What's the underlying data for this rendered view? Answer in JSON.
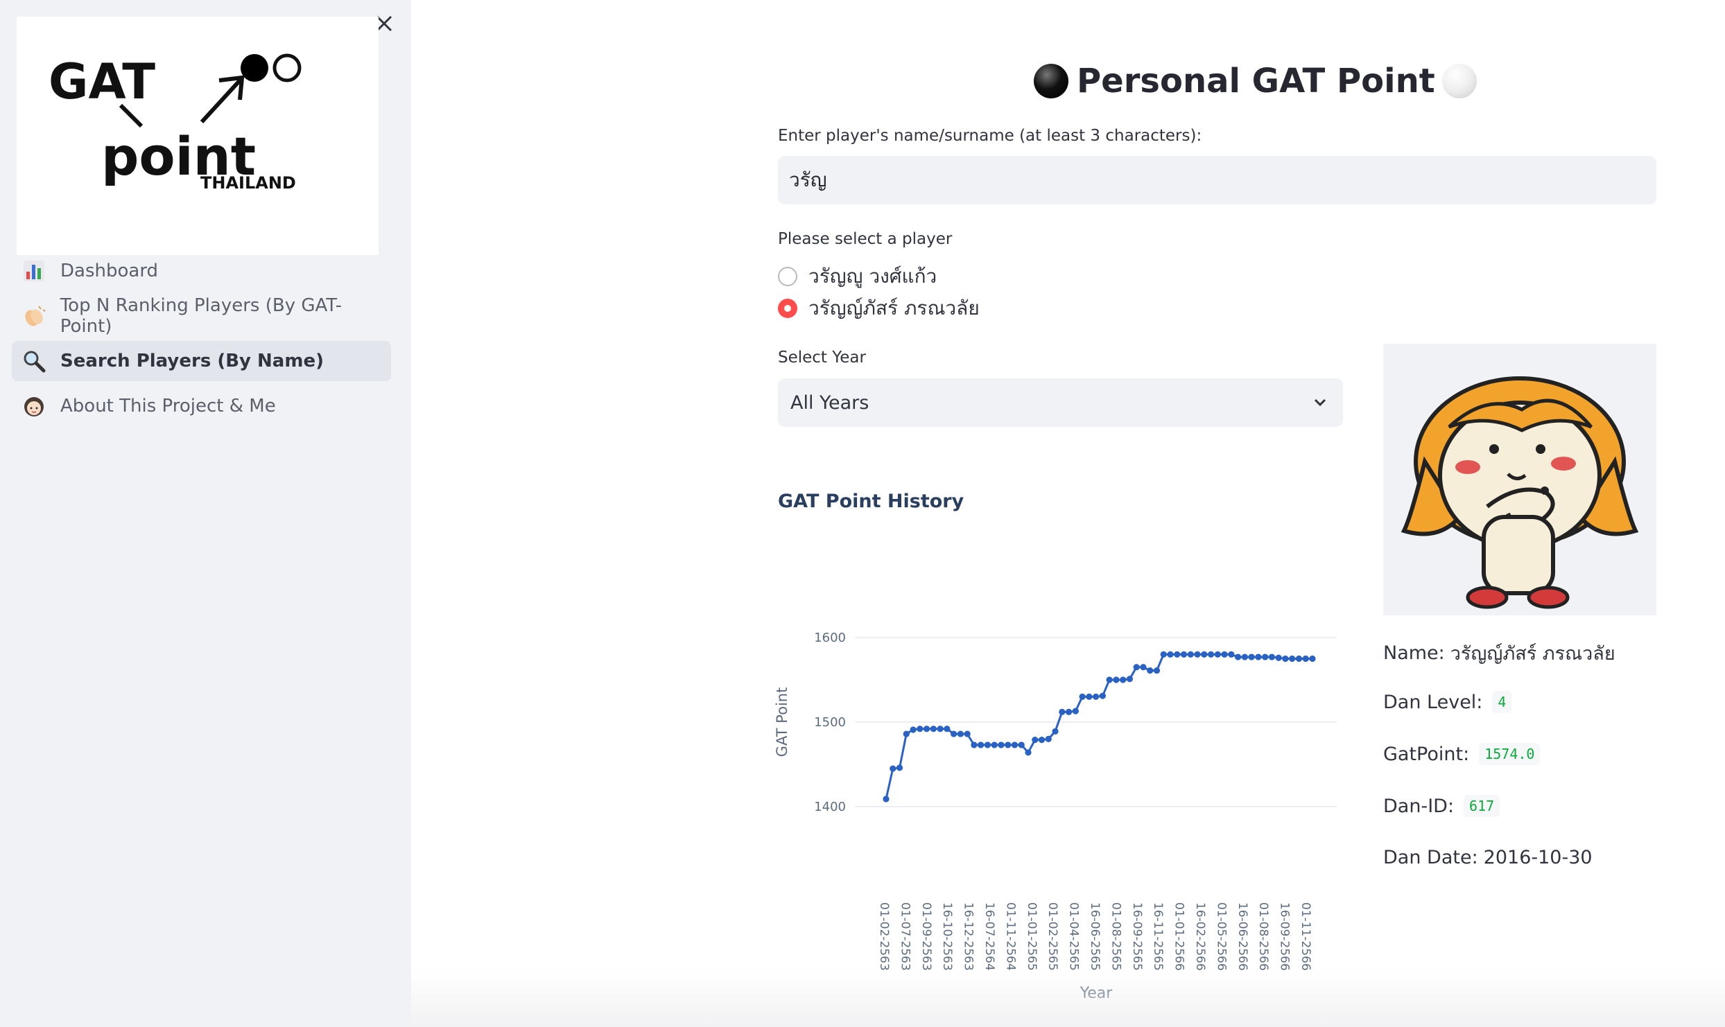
{
  "sidebar": {
    "logo": {
      "line1": "GAT",
      "line2": "point",
      "line3": "THAILAND"
    },
    "close_icon": "close-icon",
    "items": [
      {
        "label": "Dashboard",
        "icon": "bar-chart-icon",
        "active": false
      },
      {
        "label": "Top N Ranking Players (By GAT-Point)",
        "icon": "clapping-hands-icon",
        "active": false
      },
      {
        "label": "Search Players (By Name)",
        "icon": "magnifier-icon",
        "active": true
      },
      {
        "label": "About This Project & Me",
        "icon": "girl-face-icon",
        "active": false
      }
    ]
  },
  "main": {
    "title": "Personal GAT Point",
    "search": {
      "label": "Enter player's name/surname (at least 3 characters):",
      "value": "วรัญ"
    },
    "player_select": {
      "label": "Please select a player",
      "options": [
        "วรัญญู วงศ์แก้ว",
        "วรัญญ์ภัสร์ ภรณวลัย"
      ],
      "selected_index": 1
    },
    "year_select": {
      "label": "Select Year",
      "value": "All Years"
    },
    "info": {
      "name_label": "Name:",
      "name_value": "วรัญญ์ภัสร์ ภรณวลัย",
      "dan_level_label": "Dan Level:",
      "dan_level_value": "4",
      "gatpoint_label": "GatPoint:",
      "gatpoint_value": "1574.0",
      "dan_id_label": "Dan-ID:",
      "dan_id_value": "617",
      "dan_date_label": "Dan Date:",
      "dan_date_value": "2016-10-30"
    },
    "colors": {
      "accent": "#ff4b4b",
      "line": "#2a62c4",
      "code": "#09ab3b"
    }
  },
  "chart_data": {
    "type": "line",
    "title": "GAT Point History",
    "xlabel": "Year",
    "ylabel": "GAT Point",
    "yticks": [
      1400,
      1500,
      1600
    ],
    "ylim": [
      1370,
      1625
    ],
    "grid": true,
    "x_tick_labels": [
      "01-02-2563",
      "01-07-2563",
      "01-09-2563",
      "16-10-2563",
      "16-12-2563",
      "16-07-2564",
      "01-11-2564",
      "01-01-2565",
      "01-02-2565",
      "01-04-2565",
      "16-06-2565",
      "01-08-2565",
      "16-09-2565",
      "16-11-2565",
      "01-01-2566",
      "16-02-2566",
      "01-05-2566",
      "16-06-2566",
      "01-08-2566",
      "16-09-2566",
      "01-11-2566"
    ],
    "values": [
      1409,
      1445,
      1446,
      1486,
      1491,
      1492,
      1492,
      1492,
      1492,
      1492,
      1486,
      1486,
      1486,
      1473,
      1473,
      1473,
      1473,
      1473,
      1473,
      1473,
      1473,
      1464,
      1479,
      1479,
      1480,
      1489,
      1512,
      1512,
      1513,
      1530,
      1530,
      1530,
      1531,
      1550,
      1550,
      1550,
      1551,
      1565,
      1565,
      1561,
      1561,
      1580,
      1580,
      1580,
      1580,
      1580,
      1580,
      1580,
      1580,
      1580,
      1580,
      1580,
      1577,
      1577,
      1577,
      1577,
      1577,
      1577,
      1576,
      1575,
      1575,
      1575,
      1575,
      1575
    ]
  }
}
